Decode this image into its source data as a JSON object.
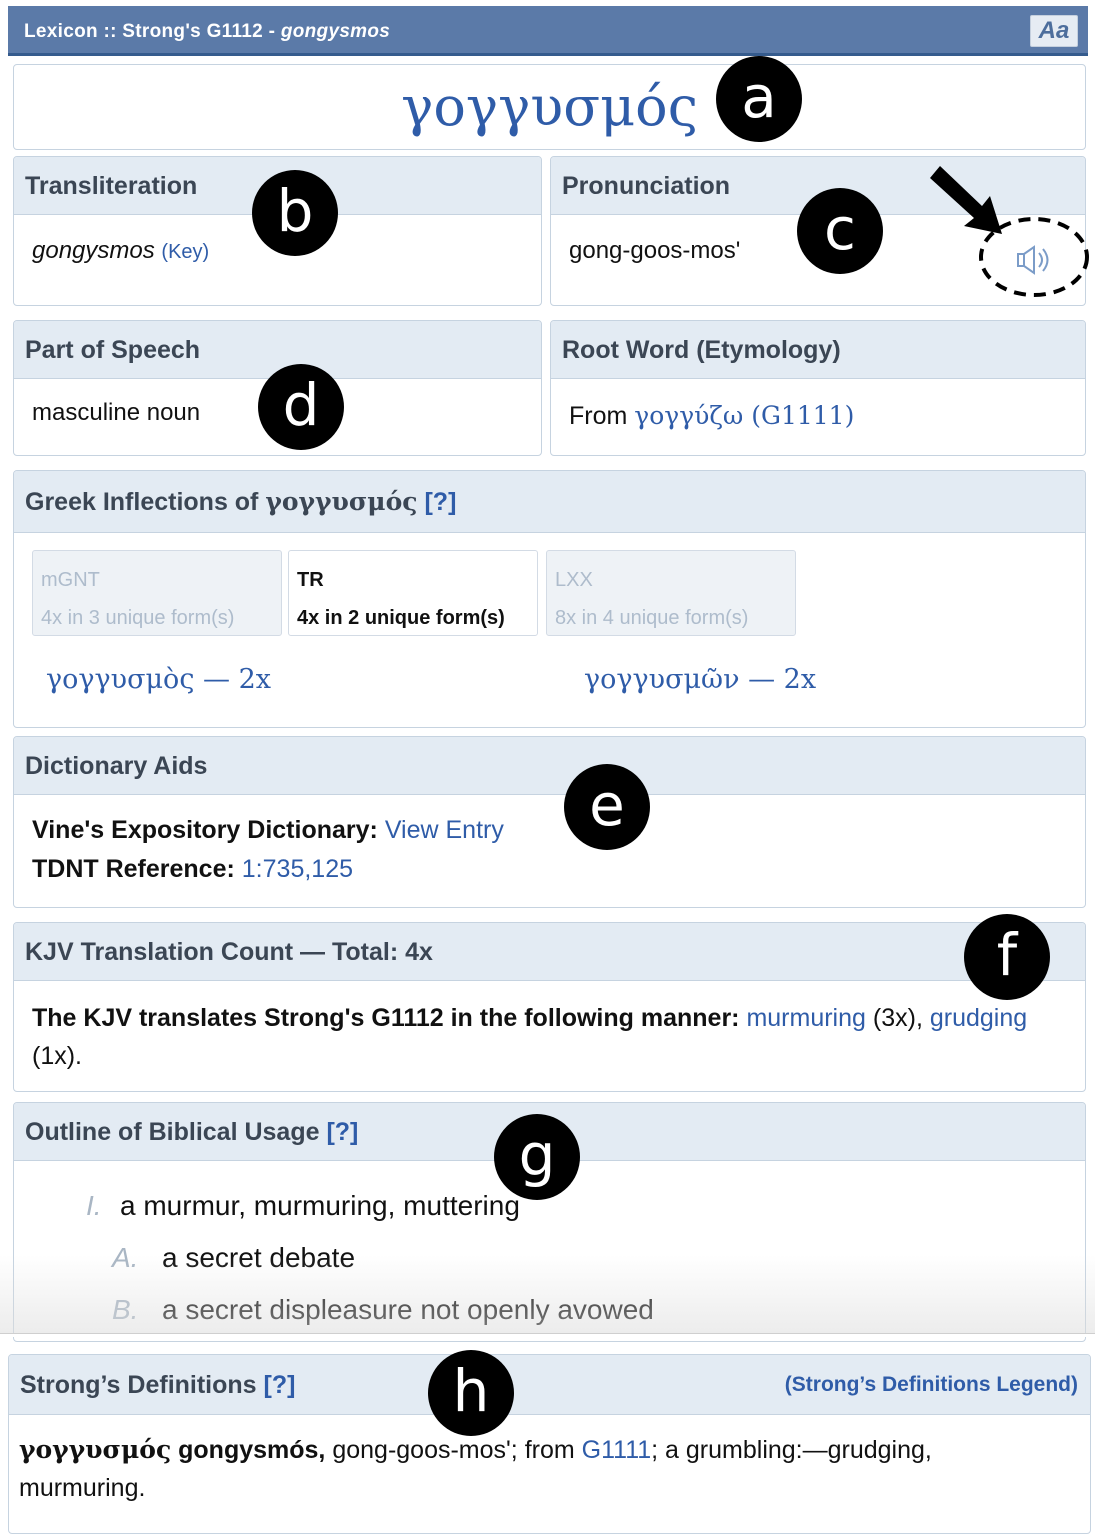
{
  "titlebar": {
    "prefix": "Lexicon :: Strong's G1112 - ",
    "translit": "gongysmos",
    "font_button": "Aa"
  },
  "headword": "γογγυσμός",
  "transliteration": {
    "heading": "Transliteration",
    "value": "gongysmos",
    "key_link": "(Key)"
  },
  "pronunciation": {
    "heading": "Pronunciation",
    "value": "gong-goos-mos'",
    "audio_icon": "speaker-icon"
  },
  "part_of_speech": {
    "heading": "Part of Speech",
    "value": "masculine noun"
  },
  "root_word": {
    "heading": "Root Word (Etymology)",
    "prefix": "From ",
    "link": "γογγύζω (G1111)"
  },
  "inflections": {
    "heading": "Greek Inflections of ",
    "heading_word": "γογγυσμός",
    "help": "[?]",
    "tabs": [
      {
        "name": "mGNT",
        "count": "4x in 3 unique form(s)"
      },
      {
        "name": "TR",
        "count": "4x in 2 unique form(s)"
      },
      {
        "name": "LXX",
        "count": "8x in 4 unique form(s)"
      }
    ],
    "forms": [
      "γογγυσμὸς — 2x",
      "γογγυσμῶν — 2x"
    ]
  },
  "dictionary_aids": {
    "heading": "Dictionary Aids",
    "vine_label": "Vine's Expository Dictionary:",
    "vine_link": "View Entry",
    "tdnt_label": "TDNT Reference:",
    "tdnt_link": "1:735,125"
  },
  "kjv": {
    "heading": "KJV Translation Count — Total: 4x",
    "lead": "The KJV translates Strong's G1112 in the following manner:",
    "w1": "murmuring",
    "c1": "(3x),",
    "w2": "grudging",
    "c2": "(1x)."
  },
  "outline": {
    "heading": "Outline of Biblical Usage",
    "help": "[?]",
    "items": [
      {
        "num": "I.",
        "text": "a murmur, murmuring, muttering"
      },
      {
        "num": "A.",
        "text": "a secret debate"
      },
      {
        "num": "B.",
        "text": "a secret displeasure not openly avowed"
      }
    ]
  },
  "strongs": {
    "heading": "Strong’s Definitions",
    "help": "[?]",
    "legend": "(Strong’s Definitions Legend)",
    "greek": "γογγυσμός",
    "translit": "gongysmós,",
    "pron": "gong-goos-mos'; from",
    "link": "G1111",
    "rest": "; a grumbling:—grudging,",
    "line2": "murmuring."
  },
  "annotations": [
    "a",
    "b",
    "c",
    "d",
    "e",
    "f",
    "g",
    "h"
  ]
}
